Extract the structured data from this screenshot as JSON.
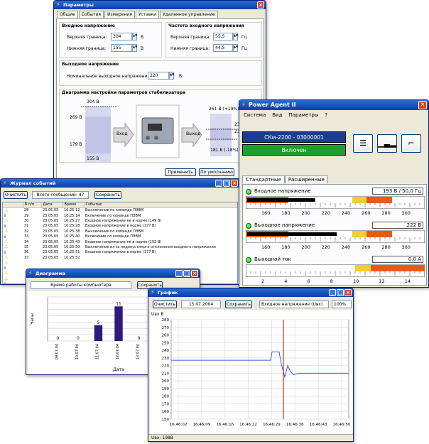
{
  "params": {
    "title": "Параметры",
    "tabs": [
      "Общие",
      "События",
      "Измерения",
      "Уставки",
      "Удаленное управление"
    ],
    "input_voltage": {
      "title": "Входное напряжение",
      "upper_label": "Верхняя граница:",
      "upper_value": "304",
      "upper_unit": "В",
      "lower_label": "Нижняя граница:",
      "lower_value": "155",
      "lower_unit": "В"
    },
    "input_freq": {
      "title": "Частота входного напряжения",
      "upper_label": "Верхняя граница:",
      "upper_value": "55,5",
      "upper_unit": "Гц",
      "lower_label": "Нижняя граница:",
      "lower_value": "44,5",
      "lower_unit": "Гц"
    },
    "output_voltage": {
      "title": "Выходное напряжение",
      "nominal_label": "Номинальное выходное напряжение:",
      "nominal_value": "220",
      "nominal_unit": "В"
    },
    "diagram": {
      "title": "Диаграмма настройки параметров стабилизатора",
      "v304": "304 В",
      "v269": "269 В",
      "v179": "179 В",
      "v155": "155 В",
      "in_label": "Вход",
      "out_label": "Выход",
      "v261": "261 В (+19%)",
      "v181": "181 В (-18%)",
      "v23a": "23",
      "v23b": "23"
    },
    "buttons": {
      "apply": "Применить",
      "default": "По умолчанию"
    }
  },
  "power_agent": {
    "title": "Power Agent II",
    "menu": [
      "Система",
      "Вид",
      "Параметры",
      "?"
    ],
    "device": "СКм-2200 - 03000001",
    "state": "Включен",
    "tabs": [
      "Стандартные",
      "Расширенные"
    ],
    "meters": [
      {
        "label": "Входное напряжение",
        "readout": "193 В / 50,0 Гц",
        "ticks": [
          "160",
          "180",
          "200",
          "220",
          "240",
          "260",
          "280",
          "300"
        ],
        "fill": 0.38
      },
      {
        "label": "Выходное напряжение",
        "readout": "222 В",
        "ticks": [
          "160",
          "180",
          "200",
          "220",
          "240",
          "260",
          "280",
          "300"
        ],
        "fill": 0.5
      },
      {
        "label": "Выходной ток",
        "readout": "0,0 А",
        "ticks": [
          "2",
          "4",
          "6",
          "8",
          "10",
          "12",
          "14"
        ],
        "fill": 0
      }
    ]
  },
  "journal": {
    "title": "Журнал событий",
    "clear": "Очистить",
    "total": "Всего сообщений: 47",
    "save": "Сохранить",
    "columns": [
      "N п/п",
      "Дата",
      "Время",
      "Событие"
    ],
    "rows": [
      {
        "t": "w",
        "n": "28",
        "d": "23.05.05",
        "time": "10:25:12",
        "e": "Выключение по команде ПЭВМ"
      },
      {
        "t": "i",
        "n": "29",
        "d": "23.05.05",
        "time": "10:25:14",
        "e": "Включение по команде ПЭВМ"
      },
      {
        "t": "w",
        "n": "30",
        "d": "23.05.05",
        "time": "10:25:27",
        "e": "Входное напряжение не в норме (149 В)"
      },
      {
        "t": "i",
        "n": "31",
        "d": "23.05.05",
        "time": "10:25:28",
        "e": "Входное напряжение в норме (177 В)"
      },
      {
        "t": "w",
        "n": "32",
        "d": "23.05.05",
        "time": "10:25:38",
        "e": "Выключение по команде ПЭВМ"
      },
      {
        "t": "i",
        "n": "33",
        "d": "23.05.05",
        "time": "10:25:40",
        "e": "Включение по команде ПЭВМ"
      },
      {
        "t": "w",
        "n": "34",
        "d": "23.05.05",
        "time": "10:25:43",
        "e": "Входное напряжение не в норме (152 В)"
      },
      {
        "t": "w",
        "n": "35",
        "d": "23.05.05",
        "time": "10:25:50",
        "e": "Выключение из-за недопустимого отклонения входного напряжения"
      },
      {
        "t": "i",
        "n": "36",
        "d": "23.05.05",
        "time": "10:25:51",
        "e": "Входное напряжение в норме (177 В)"
      },
      {
        "t": "w",
        "n": "37",
        "d": "23.05.05",
        "time": "10:25:52",
        "e": ""
      },
      {
        "t": "w",
        "n": "",
        "d": "",
        "time": "",
        "e": ""
      },
      {
        "t": "i",
        "n": "",
        "d": "",
        "time": "",
        "e": ""
      },
      {
        "t": "w",
        "n": "",
        "d": "",
        "time": "",
        "e": ""
      },
      {
        "t": "w",
        "n": "",
        "d": "",
        "time": "",
        "e": ""
      },
      {
        "t": "i",
        "n": "",
        "d": "",
        "time": "",
        "e": ""
      },
      {
        "t": "w",
        "n": "",
        "d": "",
        "time": "",
        "e": ""
      },
      {
        "t": "w",
        "n": "",
        "d": "",
        "time": "",
        "e": ""
      },
      {
        "t": "i",
        "n": "",
        "d": "",
        "time": "",
        "e": ""
      }
    ]
  },
  "histogram": {
    "title": "Диаграмма",
    "dropdown": "Время работы компьютера",
    "save": "Сохранить",
    "ylabel": "Часы",
    "xlabel": "Дата",
    "chart_data": {
      "type": "bar",
      "categories": [
        "09.07.04",
        "10.07.04",
        "11.07.04",
        "12.07.04",
        "13.07.04",
        "14.07.04",
        "15.07.04"
      ],
      "values": [
        0,
        0,
        5,
        11,
        0,
        0,
        4
      ],
      "ylabel": "Часы",
      "xlabel": "Дата",
      "ylim": [
        0,
        14
      ]
    }
  },
  "graph": {
    "title": "График",
    "clear": "Очистить",
    "date": "15.07.2004",
    "save": "Сохранить",
    "channel": "Входное напряжение (Uвх)",
    "zoom": "100%",
    "ylabel": "Uвх В",
    "status": "Uвх: 198В",
    "chart_data": {
      "type": "line",
      "yticks": [
        "280",
        "270",
        "260",
        "250",
        "240",
        "230",
        "220",
        "210",
        "200",
        "190",
        "180",
        "170",
        "160",
        "150"
      ],
      "xticks": [
        "16:46:02",
        "16:46:09",
        "16:46:16",
        "16:46:22",
        "16:46:29",
        "16:46:36",
        "16:46:43",
        "16:46:50"
      ],
      "ylim": [
        150,
        280
      ]
    }
  }
}
